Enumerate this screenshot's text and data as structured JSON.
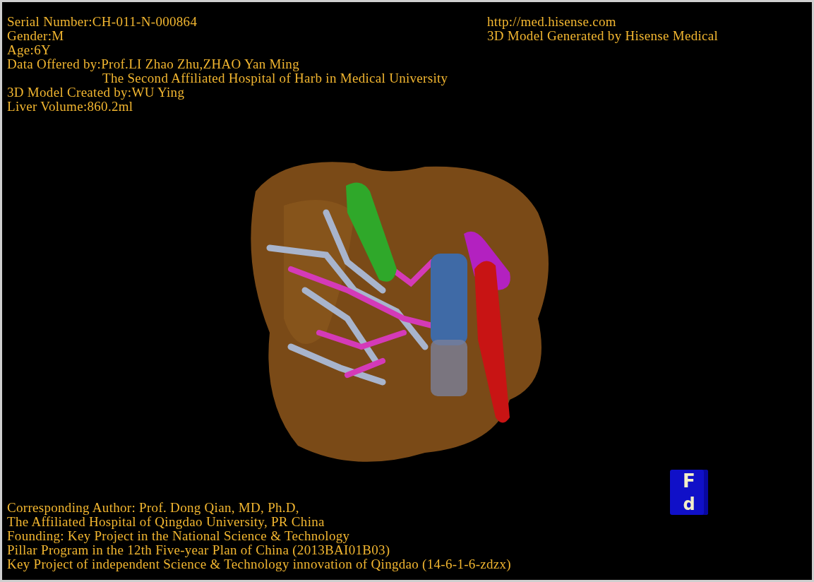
{
  "info": [
    {
      "kind": "line",
      "text": "Serial Number:CH-011-N-000864"
    },
    {
      "kind": "line",
      "text": "Gender:M"
    },
    {
      "kind": "line",
      "text": "Age:6Y"
    },
    {
      "kind": "line",
      "text": "Data Offered by:Prof.LI Zhao Zhu,ZHAO Yan Ming"
    },
    {
      "kind": "continuation",
      "text": "The Second Affiliated Hospital of Harb in Medical University"
    },
    {
      "kind": "line",
      "text": "3D Model Created by:WU Ying"
    },
    {
      "kind": "line",
      "text": "Liver Volume:860.2ml"
    }
  ],
  "info_right": [
    "http://med.hisense.com",
    "3D Model Generated by Hisense Medical"
  ],
  "orientation_cube": {
    "front": "F",
    "bottom": "d"
  },
  "credits": [
    "Corresponding Author: Prof. Dong Qian, MD, Ph.D,",
    "The Affiliated Hospital of Qingdao University, PR China",
    "Founding: Key Project in the National Science & Technology",
    "Pillar Program in the 12th Five-year Plan of China (2013BAI01B03)",
    "Key Project of independent Science & Technology innovation of Qingdao (14-6-1-6-zdzx)"
  ]
}
